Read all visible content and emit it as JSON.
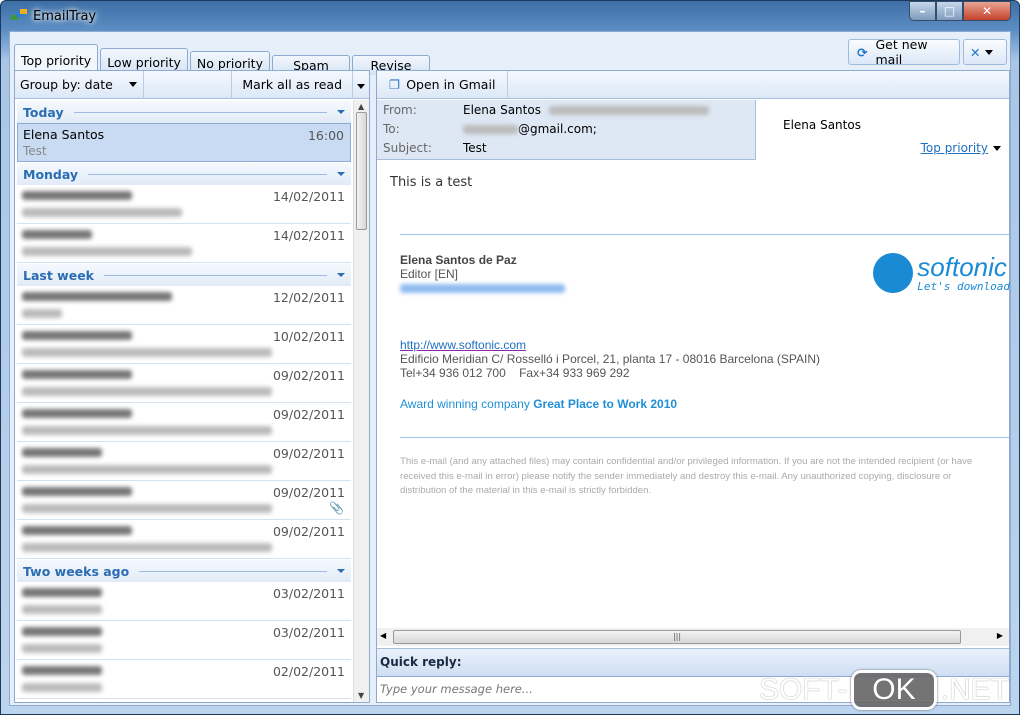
{
  "app": {
    "title": "EmailTray"
  },
  "tabs": [
    {
      "label": "Top priority"
    },
    {
      "label": "Low priority"
    },
    {
      "label": "No priority"
    },
    {
      "label": "Spam"
    },
    {
      "label": "Revise"
    }
  ],
  "toolbar": {
    "get_new_mail": "Get new mail",
    "group_by": "Group by: date",
    "mark_all_read": "Mark all as read",
    "open_in_gmail": "Open in Gmail"
  },
  "list": {
    "groups": [
      {
        "label": "Today",
        "items": [
          {
            "name": "Elena Santos",
            "subject": "Test",
            "date": "16:00",
            "selected": true
          }
        ]
      },
      {
        "label": "Monday",
        "items": [
          {
            "date": "14/02/2011"
          },
          {
            "date": "14/02/2011"
          }
        ]
      },
      {
        "label": "Last week",
        "items": [
          {
            "date": "12/02/2011"
          },
          {
            "date": "10/02/2011"
          },
          {
            "date": "09/02/2011"
          },
          {
            "date": "09/02/2011"
          },
          {
            "date": "09/02/2011"
          },
          {
            "date": "09/02/2011",
            "attachment": true
          },
          {
            "date": "09/02/2011"
          }
        ]
      },
      {
        "label": "Two weeks ago",
        "items": [
          {
            "date": "03/02/2011"
          },
          {
            "date": "03/02/2011"
          },
          {
            "date": "02/02/2011"
          }
        ]
      }
    ]
  },
  "message": {
    "from_label": "From:",
    "from": "Elena Santos",
    "to_label": "To:",
    "to": "@gmail.com;",
    "subject_label": "Subject:",
    "subject": "Test",
    "contact_name": "Elena Santos",
    "priority": "Top priority",
    "body": "This is a test",
    "sig_name": "Elena Santos de Paz",
    "sig_role": "Editor [EN]",
    "sig_url": "http://www.softonic.com",
    "sig_address": "Edificio Meridian C/ Rosselló i Porcel, 21, planta 17 - 08016 Barcelona (SPAIN)",
    "sig_phone": "Tel+34 936 012 700    Fax+34 933 969 292",
    "award_prefix": "Award winning company ",
    "award": "Great Place to Work 2010",
    "logo_text": "softonic",
    "logo_tagline": "Let's download",
    "disclaimer": "This e-mail (and any attached files) may contain confidential and/or privileged information. If you are not the intended recipient (or have received this e-mail in error) please notify the sender immediately and destroy this e-mail. Any unauthorized copying, disclosure or distribution of the material in this e-mail is strictly forbidden."
  },
  "quick_reply": {
    "label": "Quick reply:",
    "placeholder": "Type your message here..."
  },
  "watermark": {
    "left": "SOFT-",
    "mid": "OK",
    "right": ".NET"
  },
  "colors": {
    "accent": "#2a6db2",
    "link": "#1f8fd6",
    "logo": "#1a8ad4"
  }
}
